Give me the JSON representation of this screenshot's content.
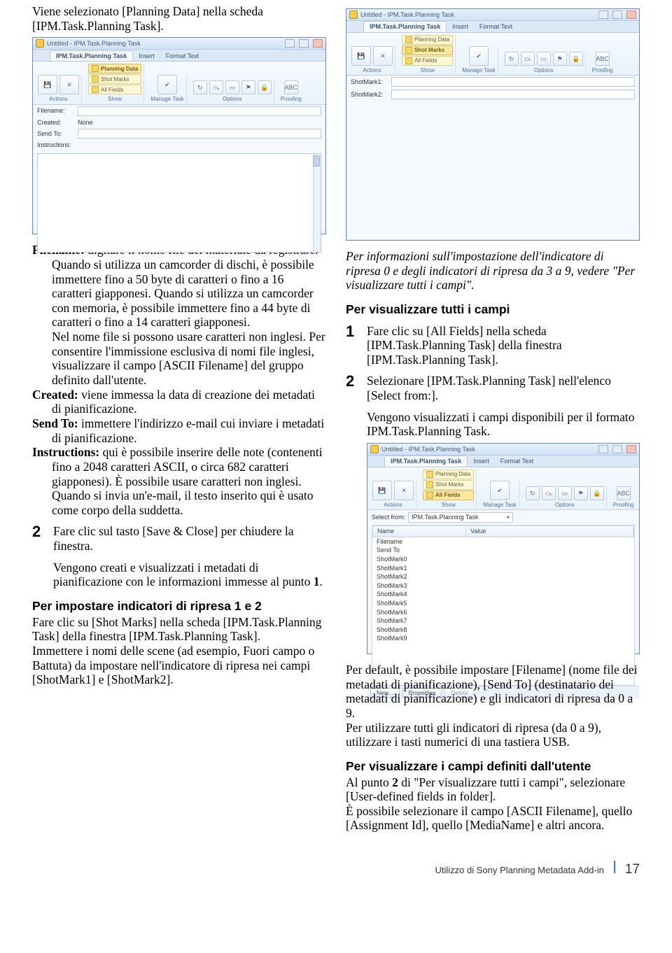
{
  "left": {
    "intro": "Viene selezionato [Planning Data] nella scheda [IPM.Task.Planning Task].",
    "shot1": {
      "title": "Untitled - IPM.Task.Planning Task",
      "tabs": [
        "IPM.Task.Planning Task",
        "Insert",
        "Format Text"
      ],
      "pills": [
        "Planning Data",
        "Shot Marks",
        "All Fields"
      ],
      "groups": {
        "g1": "Actions",
        "g2": "Show",
        "g3": "Manage Task",
        "g4": "Options",
        "g5": "Proofing"
      },
      "btns": {
        "save": "Save & Close",
        "del": "Delete",
        "mark": "Mark Complete",
        "rec": "Recurrence",
        "skip": "Skip Occurrence",
        "cat": "Categorize",
        "fu": "Follow Up",
        "priv": "Private",
        "sp": "Spelling"
      },
      "fields": {
        "filename": "Filename:",
        "created": "Created:",
        "createdVal": "None",
        "sendto": "Send To:",
        "instr": "Instructions:"
      }
    },
    "f_filename_lead": "Filename: ",
    "f_filename": "digitare il nome file del materiale da registrare. Quando si utilizza un camcorder di dischi, è possibile immettere fino a 50 byte di caratteri o fino a 16 caratteri giapponesi. Quando si utilizza un camcorder con memoria, è possibile immettere fino a 44 byte di caratteri o fino a 14 caratteri giapponesi.",
    "f_filename2": "Nel nome file si possono usare caratteri non inglesi. Per consentire l'immissione esclusiva di nomi file inglesi, visualizzare il campo [ASCII Filename] del gruppo definito dall'utente.",
    "f_created_lead": "Created: ",
    "f_created": "viene immessa la data di creazione dei metadati di pianificazione.",
    "f_sendto_lead": "Send To: ",
    "f_sendto": "immettere l'indirizzo e-mail cui inviare i metadati di pianificazione.",
    "f_instr_lead": "Instructions: ",
    "f_instr": "qui è possibile inserire delle note (contenenti fino a 2048 caratteri ASCII, o circa 682 caratteri giapponesi). È possibile usare caratteri non inglesi.",
    "f_instr2": "Quando si invia un'e-mail, il testo inserito qui è usato come corpo della suddetta.",
    "step2": "Fare clic sul tasto [Save & Close] per chiudere la finestra.",
    "step2b": "Vengono creati e visualizzati i metadati di pianificazione con le informazioni immesse al punto ",
    "step2b_num": "1",
    "step2b_dot": ".",
    "h_shot": "Per impostare indicatori di ripresa 1 e 2",
    "shot_p": "Fare clic su [Shot Marks] nella scheda [IPM.Task.Planning Task] della finestra [IPM.Task.Planning Task].",
    "shot_p2": "Immettere i nomi delle scene (ad esempio, Fuori campo o Battuta) da impostare nell'indicatore di ripresa nei campi [ShotMark1] e [ShotMark2]."
  },
  "right": {
    "shot2": {
      "title": "Untitled - IPM.Task.Planning Task",
      "tabs": [
        "IPM.Task.Planning Task",
        "Insert",
        "Format Text"
      ],
      "pills": [
        "Planning Data",
        "Shot Marks",
        "All Fields"
      ],
      "groups": {
        "g1": "Actions",
        "g2": "Show",
        "g3": "Manage Task",
        "g4": "Options",
        "g5": "Proofing"
      },
      "fields": {
        "sm1": "ShotMark1:",
        "sm2": "ShotMark2:"
      }
    },
    "note_i": "Per informazioni sull'impostazione dell'indicatore di ripresa 0 e degli indicatori di ripresa da 3 a 9, vedere \"Per visualizzare tutti i campi\".",
    "h_all": "Per visualizzare tutti i campi",
    "s1": "Fare clic su [All Fields] nella scheda [IPM.Task.Planning Task] della finestra [IPM.Task.Planning Task].",
    "s2": "Selezionare [IPM.Task.Planning Task] nell'elenco [Select from:].",
    "s2b": "Vengono visualizzati i campi disponibili per il formato IPM.Task.Planning Task.",
    "shot3": {
      "title": "Untitled - IPM.Task.Planning Task",
      "tabs": [
        "IPM.Task.Planning Task",
        "Insert",
        "Format Text"
      ],
      "selectFromLabel": "Select from:",
      "selectFromValue": "IPM.Task.Planning Task",
      "hdrName": "Name",
      "hdrValue": "Value",
      "rows": [
        "Filename",
        "Send To",
        "ShotMark0",
        "ShotMark1",
        "ShotMark2",
        "ShotMark3",
        "ShotMark4",
        "ShotMark5",
        "ShotMark6",
        "ShotMark7",
        "ShotMark8",
        "ShotMark9"
      ],
      "btnNew": "New...",
      "btnProp": "Properties",
      "btnDel": "Delete"
    },
    "after1": "Per default, è possibile impostare [Filename] (nome file dei metadati di pianificazione), [Send To] (destinatario dei metadati di pianificazione) e gli indicatori di ripresa da 0 a 9.",
    "after2": "Per utilizzare tutti gli indicatori di ripresa (da 0 a 9), utilizzare i tasti numerici di una tastiera USB.",
    "h_user": "Per visualizzare i campi definiti dall'utente",
    "user1a": "Al punto ",
    "user1b": "2",
    "user1c": " di \"Per visualizzare tutti i campi\", selezionare [User-defined fields in folder].",
    "user2": "È possibile selezionare il campo [ASCII Filename], quello [Assignment Id], quello [MediaName] e altri ancora."
  },
  "footer": {
    "label": "Utilizzo di Sony Planning Metadata Add-in",
    "page": "17"
  }
}
